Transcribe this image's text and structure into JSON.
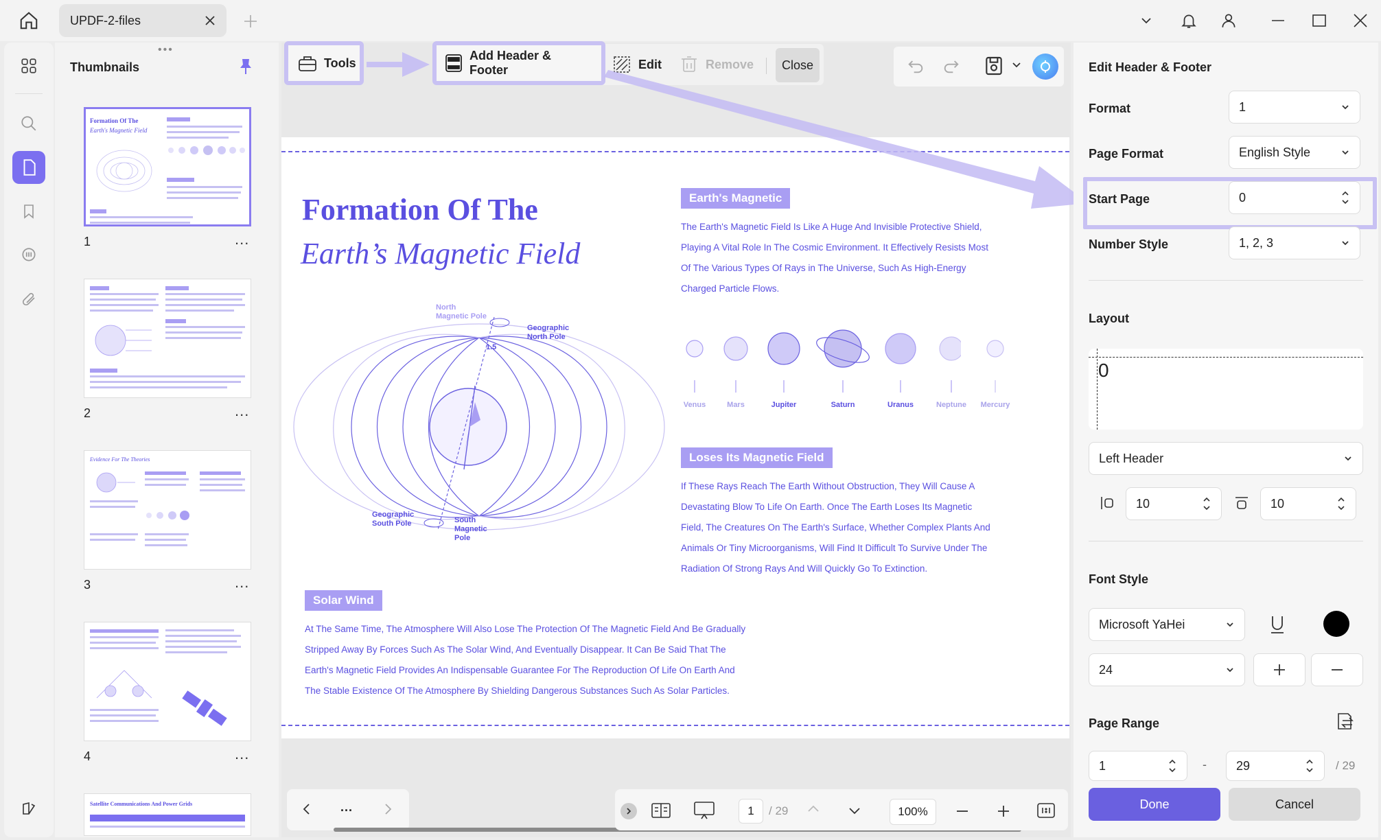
{
  "window": {
    "tab_title": "UPDF-2-files"
  },
  "thumbnails": {
    "title": "Thumbnails",
    "pages": [
      {
        "num": "1"
      },
      {
        "num": "2"
      },
      {
        "num": "3"
      },
      {
        "num": "4"
      }
    ],
    "more": "...",
    "thumb1": {
      "title": "Formation Of The",
      "subtitle": "Earth's Magnetic Field"
    },
    "thumb3": {
      "title": "Evidence For The Theories"
    },
    "thumb5": {
      "title": "Satellite Communications And Power Grids"
    }
  },
  "toolbar": {
    "tools": "Tools",
    "add_header_footer": "Add Header & Footer",
    "edit": "Edit",
    "remove": "Remove",
    "close": "Close"
  },
  "document": {
    "title_line1": "Formation Of The",
    "title_line2": "Earth’s Magnetic Field",
    "section1_heading": "Earth's Magnetic",
    "section1_lines": [
      "The Earth's Magnetic Field Is Like A Huge And Invisible Protective Shield,",
      "Playing A Vital Role In The Cosmic Environment. It Effectively Resists Most",
      "Of The Various Types Of Rays in The Universe, Such As High-Energy",
      "Charged Particle Flows."
    ],
    "planets": [
      "Venus",
      "Mars",
      "Jupiter",
      "Saturn",
      "Uranus",
      "Neptune",
      "Mercury"
    ],
    "diagram_labels": {
      "north_magnetic": "North\nMagnetic Pole",
      "geo_north": "Geographic\nNorth Pole",
      "angle": "1.5",
      "geo_south": "Geographic\nSouth Pole",
      "south_magnetic": "South\nMagnetic\nPole"
    },
    "section2_heading": "Loses Its Magnetic Field",
    "section2_lines": [
      "If These Rays Reach The Earth Without Obstruction, They Will Cause A",
      "Devastating Blow To Life On Earth. Once The Earth Loses Its Magnetic",
      "Field, The Creatures On The Earth's Surface, Whether Complex Plants And",
      "Animals Or Tiny Microorganisms, Will Find It Difficult To Survive Under The",
      "Radiation Of Strong Rays And Will Quickly Go To Extinction."
    ],
    "section3_heading": "Solar Wind",
    "section3_lines": [
      "At The Same Time, The Atmosphere Will Also Lose The Protection Of The Magnetic Field And Be Gradually",
      "Stripped Away By Forces Such As The Solar Wind, And Eventually Disappear. It Can Be Said That The",
      "Earth's Magnetic Field Provides An Indispensable Guarantee For The Reproduction Of Life On Earth And",
      "The Stable Existence Of The Atmosphere By Shielding Dangerous Substances Such As Solar Particles."
    ]
  },
  "bottom": {
    "more": "...",
    "page_current": "1",
    "page_total": "/ 29",
    "zoom": "100%"
  },
  "panel": {
    "title": "Edit Header & Footer",
    "format_label": "Format",
    "format_value": "1",
    "page_format_label": "Page Format",
    "page_format_value": "English Style",
    "start_page_label": "Start Page",
    "start_page_value": "0",
    "number_style_label": "Number Style",
    "number_style_value": "1, 2, 3",
    "layout_label": "Layout",
    "layout_preview": "0",
    "position_value": "Left Header",
    "margin_left_value": "10",
    "margin_top_value": "10",
    "font_style_label": "Font Style",
    "font_value": "Microsoft YaHei",
    "font_size_value": "24",
    "page_range_label": "Page Range",
    "range_start": "1",
    "range_dash": "-",
    "range_end": "29",
    "range_total": "/ 29",
    "done": "Done",
    "cancel": "Cancel"
  },
  "colors": {
    "accent": "#6a60e0",
    "highlight": "#c8c1f3",
    "done_button": "#6a60e0"
  }
}
